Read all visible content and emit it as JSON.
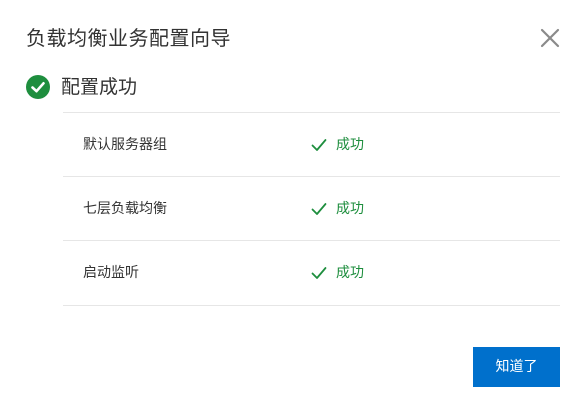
{
  "dialog": {
    "title": "负载均衡业务配置向导",
    "close_icon": "close-icon"
  },
  "status": {
    "icon": "check-circle-icon",
    "text": "配置成功",
    "color": "#1e8e3e"
  },
  "steps": [
    {
      "name": "默认服务器组",
      "status": "成功",
      "icon": "check-icon"
    },
    {
      "name": "七层负载均衡",
      "status": "成功",
      "icon": "check-icon"
    },
    {
      "name": "启动监听",
      "status": "成功",
      "icon": "check-icon"
    }
  ],
  "footer": {
    "ok_label": "知道了",
    "button_color": "#0070cc"
  }
}
